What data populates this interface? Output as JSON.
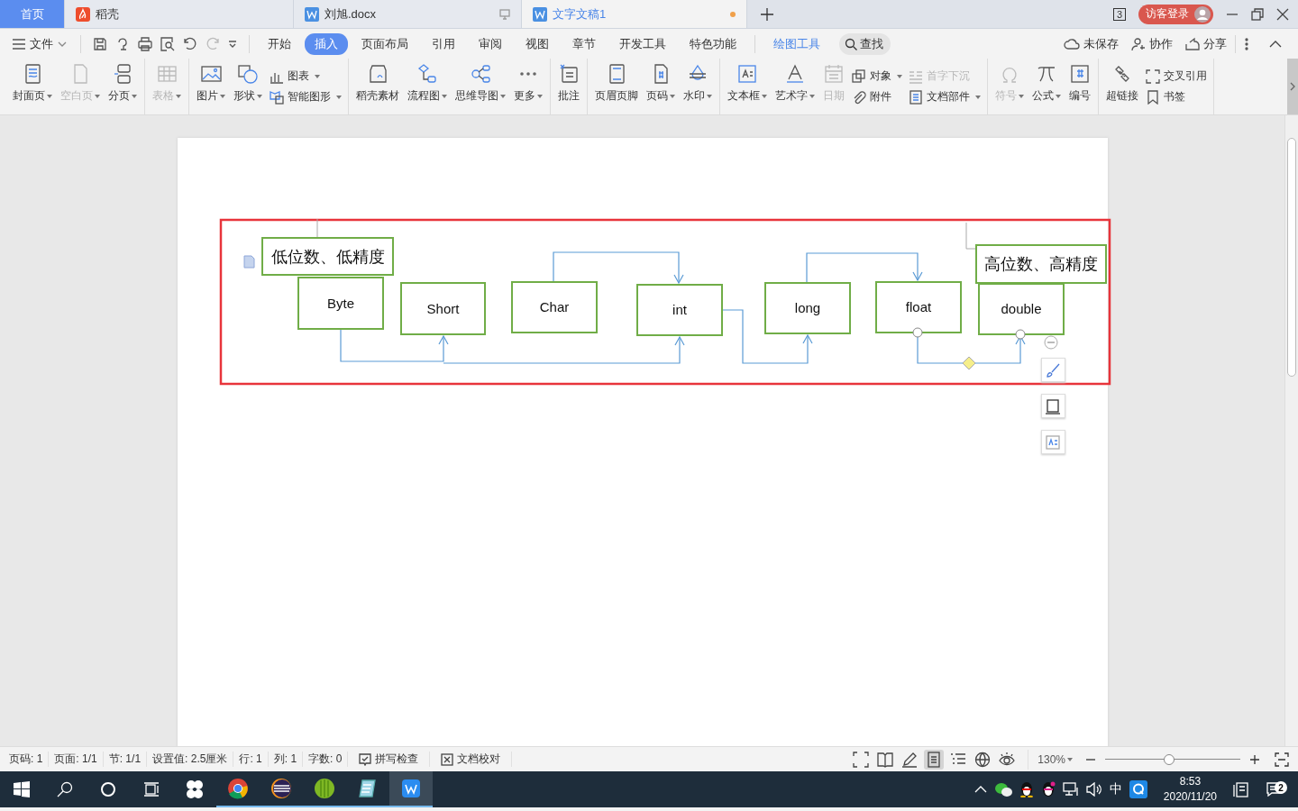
{
  "tabs": [
    {
      "label": "首页",
      "kind": "home",
      "selected": false,
      "unsaved": false
    },
    {
      "label": "稻壳",
      "kind": "docer",
      "selected": false,
      "unsaved": false
    },
    {
      "label": "刘旭.docx",
      "kind": "doc",
      "selected": false,
      "unsaved": false
    },
    {
      "label": "文字文稿1",
      "kind": "doc",
      "selected": true,
      "unsaved": true
    }
  ],
  "tab_count": "3",
  "account": {
    "label": "访客登录"
  },
  "menu": {
    "file_label": "文件",
    "tabs": [
      {
        "label": "开始",
        "kind": "tab",
        "selected": false
      },
      {
        "label": "插入",
        "kind": "tab",
        "selected": true
      },
      {
        "label": "页面布局",
        "kind": "tab",
        "selected": false
      },
      {
        "label": "引用",
        "kind": "tab",
        "selected": false
      },
      {
        "label": "审阅",
        "kind": "tab",
        "selected": false
      },
      {
        "label": "视图",
        "kind": "tab",
        "selected": false
      },
      {
        "label": "章节",
        "kind": "tab",
        "selected": false
      },
      {
        "label": "开发工具",
        "kind": "tab",
        "selected": false
      },
      {
        "label": "特色功能",
        "kind": "tab",
        "selected": false
      },
      {
        "label": "绘图工具",
        "kind": "context",
        "selected": false
      }
    ],
    "search_label": "查找",
    "actions": [
      "未保存",
      "协作",
      "分享"
    ]
  },
  "ribbon": {
    "groups": [
      {
        "items": [
          {
            "kind": "large",
            "label": "封面页",
            "dropdown": true,
            "disabled": false
          },
          {
            "kind": "large",
            "label": "空白页",
            "dropdown": true,
            "disabled": true
          },
          {
            "kind": "large",
            "label": "分页",
            "dropdown": true,
            "disabled": false
          }
        ]
      },
      {
        "items": [
          {
            "kind": "large",
            "label": "表格",
            "dropdown": true,
            "disabled": true
          }
        ]
      },
      {
        "items": [
          {
            "kind": "large",
            "label": "图片",
            "dropdown": true,
            "disabled": false
          },
          {
            "kind": "large",
            "label": "形状",
            "dropdown": true,
            "disabled": false
          },
          {
            "kind": "stack",
            "items": [
              {
                "label": "图表",
                "dropdown": true,
                "disabled": false
              },
              {
                "label": "智能图形",
                "dropdown": true,
                "disabled": false
              }
            ]
          }
        ]
      },
      {
        "items": [
          {
            "kind": "large",
            "label": "稻壳素材",
            "dropdown": false,
            "disabled": false
          },
          {
            "kind": "large",
            "label": "流程图",
            "dropdown": true,
            "disabled": false
          },
          {
            "kind": "large",
            "label": "思维导图",
            "dropdown": true,
            "disabled": false
          },
          {
            "kind": "large",
            "label": "更多",
            "dropdown": true,
            "disabled": false
          }
        ]
      },
      {
        "items": [
          {
            "kind": "large",
            "label": "批注",
            "dropdown": false,
            "disabled": false
          }
        ]
      },
      {
        "items": [
          {
            "kind": "large",
            "label": "页眉页脚",
            "dropdown": false,
            "disabled": false
          },
          {
            "kind": "large",
            "label": "页码",
            "dropdown": true,
            "disabled": false
          },
          {
            "kind": "large",
            "label": "水印",
            "dropdown": true,
            "disabled": false
          }
        ]
      },
      {
        "items": [
          {
            "kind": "large",
            "label": "文本框",
            "dropdown": true,
            "disabled": false
          },
          {
            "kind": "large",
            "label": "艺术字",
            "dropdown": true,
            "disabled": false
          },
          {
            "kind": "large",
            "label": "日期",
            "dropdown": false,
            "disabled": true
          },
          {
            "kind": "stack",
            "items": [
              {
                "label": "对象",
                "dropdown": true,
                "disabled": false
              },
              {
                "label": "附件",
                "dropdown": false,
                "disabled": false
              }
            ]
          },
          {
            "kind": "stack",
            "items": [
              {
                "label": "首字下沉",
                "dropdown": false,
                "disabled": true
              },
              {
                "label": "文档部件",
                "dropdown": true,
                "disabled": false
              }
            ]
          }
        ]
      },
      {
        "items": [
          {
            "kind": "large",
            "label": "符号",
            "dropdown": true,
            "disabled": true
          },
          {
            "kind": "large",
            "label": "公式",
            "dropdown": true,
            "disabled": false
          },
          {
            "kind": "large",
            "label": "编号",
            "dropdown": false,
            "disabled": false
          }
        ]
      },
      {
        "items": [
          {
            "kind": "large",
            "label": "超链接",
            "dropdown": false,
            "disabled": false
          },
          {
            "kind": "stack",
            "items": [
              {
                "label": "交叉引用",
                "dropdown": false,
                "disabled": false
              },
              {
                "label": "书签",
                "dropdown": false,
                "disabled": false
              }
            ]
          }
        ]
      }
    ]
  },
  "diagram": {
    "selected": true,
    "nodes": [
      {
        "label": "低位数、低精度",
        "kind": "note"
      },
      {
        "label": "Byte",
        "kind": "box"
      },
      {
        "label": "Short",
        "kind": "box"
      },
      {
        "label": "Char",
        "kind": "box"
      },
      {
        "label": "int",
        "kind": "box"
      },
      {
        "label": "long",
        "kind": "box"
      },
      {
        "label": "float",
        "kind": "box"
      },
      {
        "label": "double",
        "kind": "box"
      },
      {
        "label": "高位数、高精度",
        "kind": "note"
      }
    ]
  },
  "status_bar": {
    "items": [
      "页码: 1",
      "页面: 1/1",
      "节: 1/1",
      "设置值: 2.5厘米",
      "行: 1",
      "列: 1",
      "字数: 0"
    ],
    "tools": [
      "拼写检查",
      "文档校对"
    ],
    "views": [
      {
        "selected": false
      },
      {
        "selected": false
      },
      {
        "selected": false
      },
      {
        "selected": true
      },
      {
        "selected": false
      },
      {
        "selected": false
      },
      {
        "selected": false
      }
    ],
    "zoom": "130%",
    "zoom_slider": {
      "level": 0.47
    }
  },
  "taskbar": {
    "apps": [
      {
        "running": false,
        "selected": false
      },
      {
        "running": true,
        "selected": false
      },
      {
        "running": true,
        "selected": false
      },
      {
        "running": true,
        "selected": false
      },
      {
        "running": true,
        "selected": false
      },
      {
        "running": true,
        "selected": true
      }
    ],
    "ime": "中",
    "time": "8:53",
    "date": "2020/11/20",
    "notifications": "2"
  }
}
